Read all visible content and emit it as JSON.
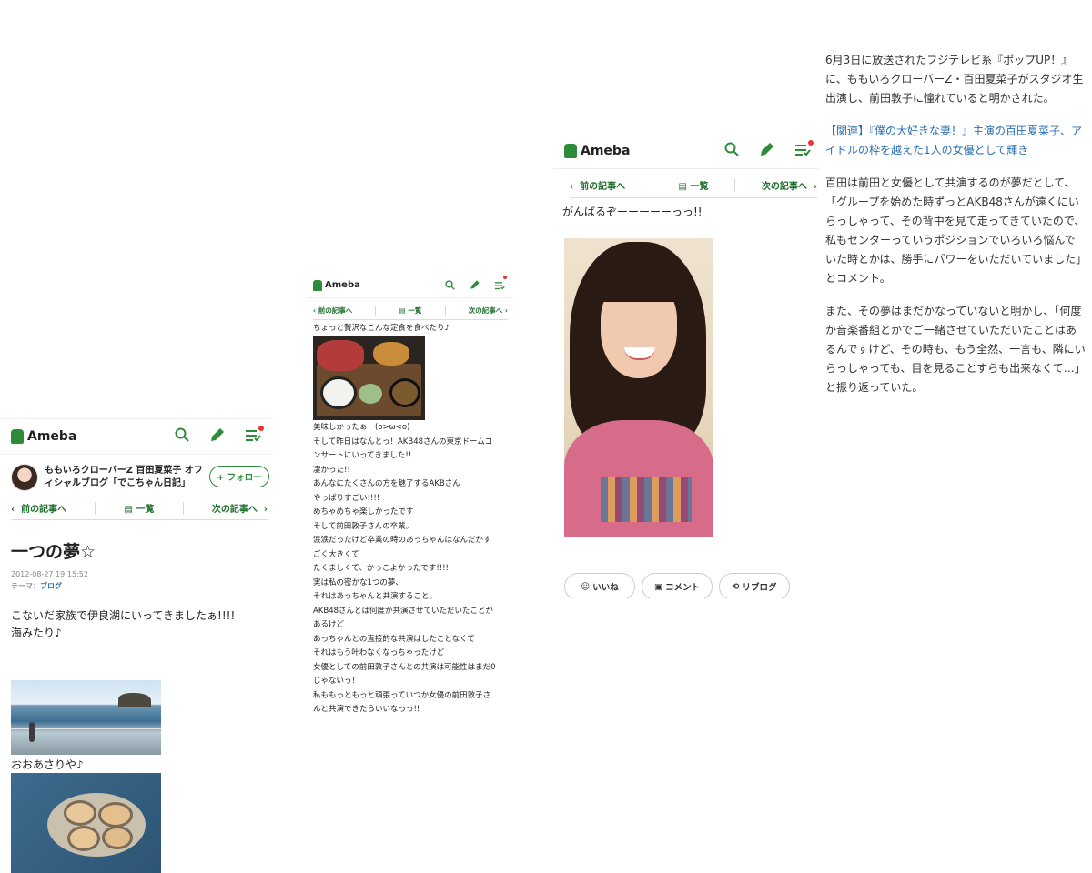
{
  "panel1": {
    "logo": "Ameba",
    "blog_name_line1": "ももいろクローバーZ 百田夏菜子 オフ",
    "blog_name_line2": "ィシャルブログ「でこちゃん日記」",
    "follow": "+ フォロー",
    "prev": "前の記事へ",
    "list": "一覧",
    "next": "次の記事へ",
    "title": "一つの夢☆",
    "date": "2012-08-27 19:15:52",
    "theme_label": "テーマ：",
    "theme": "ブログ",
    "body1": "こないだ家族で伊良湖にいってきましたぁ!!!!",
    "body2": "海みたり♪",
    "caption": "おおあさりや♪"
  },
  "panel2": {
    "logo": "Ameba",
    "prev": "前の記事へ",
    "list": "一覧",
    "next": "次の記事へ",
    "lines": [
      "ちょっと贅沢なこんな定食を食べたり♪",
      "美味しかったぁー(o>ω<o)",
      "そして昨日はなんとっ！AKB48さんの東京ドームコ",
      "ンサートにいってきました!!",
      "凄かった!!",
      "あんなにたくさんの方を魅了するAKBさん",
      "やっぱりすごい!!!!",
      "めちゃめちゃ楽しかったです",
      "そして前田敦子さんの卒業。",
      "涙涙だったけど卒業の時のあっちゃんはなんだかす",
      "ごく大きくて",
      "たくましくて、かっこよかったです!!!!",
      "実は私の密かな1つの夢、",
      "それはあっちゃんと共演すること。",
      "AKB48さんとは何度か共演させていただいたことが",
      "あるけど",
      "あっちゃんとの直接的な共演はしたことなくて",
      "それはもう叶わなくなっちゃったけど",
      "女優としての前田敦子さんとの共演は可能性はまだ0",
      "じゃないっ！",
      "私ももっともっと頑張っていつか女優の前田敦子さ",
      "んと共演できたらいいなっっ!!"
    ]
  },
  "panel3": {
    "logo": "Ameba",
    "prev": "前の記事へ",
    "list": "一覧",
    "next": "次の記事へ",
    "top_text": "がんばるぞーーーーーっっ!!",
    "like": "いいね",
    "comment": "コメント",
    "reblog": "リブログ"
  },
  "article": {
    "p1": [
      "6月3日に放送されたフジテレビ系『ポップUP！』",
      "に、ももいろクローバーZ・百田夏菜子がスタジオ生",
      "出演し、前田敦子に憧れていると明かされた。"
    ],
    "link": [
      "【関連】『僕の大好きな妻！』主演の百田夏菜子、ア",
      "イドルの枠を越えた1人の女優として輝き"
    ],
    "p2": [
      "百田は前田と女優として共演するのが夢だとして、",
      "「グループを始めた時ずっとAKB48さんが遠くにい",
      "らっしゃって、その背中を見て走ってきていたので、",
      "私もセンターっていうポジションでいろいろ悩んで",
      "いた時とかは、勝手にパワーをいただいていました」",
      "とコメント。"
    ],
    "p3": [
      "また、その夢はまだかなっていないと明かし、「何度",
      "か音楽番組とかでご一緒させていただいたことはあ",
      "るんですけど、その時も、もう全然、一言も、隣にい",
      "らっしゃっても、目を見ることすらも出来なくて…」",
      "と振り返っていた。"
    ]
  },
  "colors": {
    "ameba_green": "#2e8b3a",
    "link_blue": "#2a6fb5",
    "notify_red": "#e33333"
  }
}
